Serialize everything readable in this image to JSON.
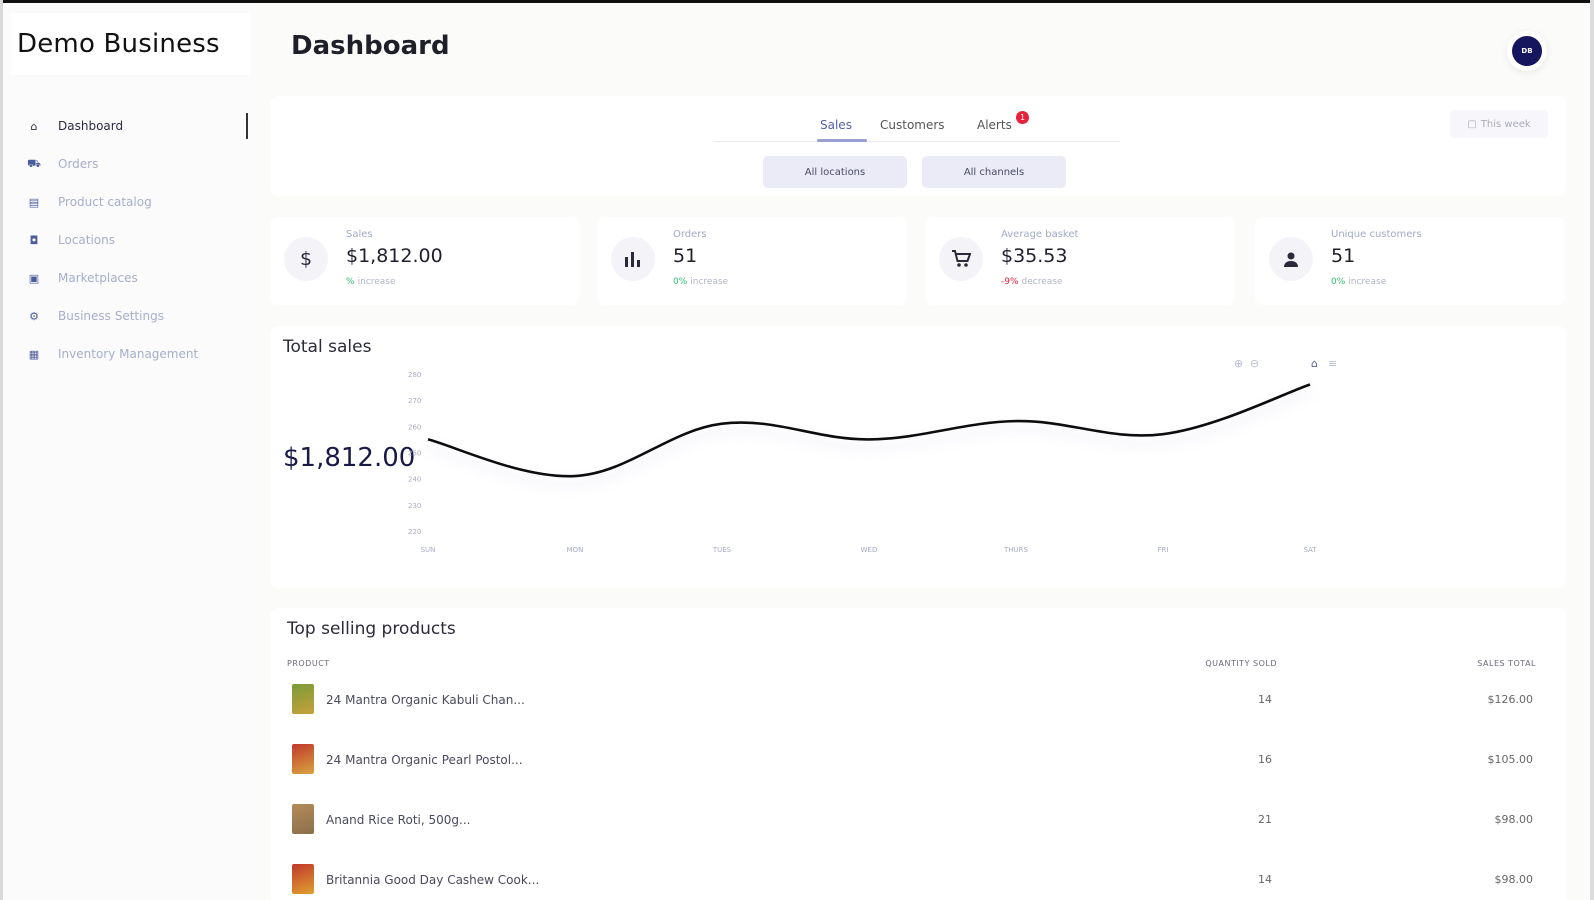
{
  "brand": {
    "name": "Demo Business"
  },
  "sidebar": {
    "items": [
      {
        "label": "Dashboard",
        "icon": "home-icon",
        "glyph": "⌂",
        "active": true
      },
      {
        "label": "Orders",
        "icon": "cart-icon",
        "glyph": "⛟",
        "active": false
      },
      {
        "label": "Product catalog",
        "icon": "catalog-icon",
        "glyph": "▤",
        "active": false
      },
      {
        "label": "Locations",
        "icon": "location-icon",
        "glyph": "◘",
        "active": false
      },
      {
        "label": "Marketplaces",
        "icon": "store-icon",
        "glyph": "▣",
        "active": false
      },
      {
        "label": "Business Settings",
        "icon": "gear-icon",
        "glyph": "⚙",
        "active": false
      },
      {
        "label": "Inventory Management",
        "icon": "inventory-icon",
        "glyph": "▦",
        "active": false
      }
    ]
  },
  "header": {
    "title": "Dashboard",
    "avatar_initials": "DB"
  },
  "filters": {
    "tabs": [
      {
        "label": "Sales",
        "active": true
      },
      {
        "label": "Customers",
        "active": false
      },
      {
        "label": "Alerts",
        "active": false,
        "badge": "1"
      }
    ],
    "period_label": "This week",
    "locations_label": "All locations",
    "channels_label": "All channels"
  },
  "stats": [
    {
      "label": "Sales",
      "value": "$1,812.00",
      "delta": "%",
      "direction": "up",
      "delta_word": "increase",
      "icon": "dollar-icon"
    },
    {
      "label": "Orders",
      "value": "51",
      "delta": "0%",
      "direction": "up",
      "delta_word": "increase",
      "icon": "bar-chart-icon"
    },
    {
      "label": "Average basket",
      "value": "$35.53",
      "delta": "-9%",
      "direction": "down",
      "delta_word": "decrease",
      "icon": "cart-icon"
    },
    {
      "label": "Unique customers",
      "value": "51",
      "delta": "0%",
      "direction": "up",
      "delta_word": "increase",
      "icon": "user-icon"
    }
  ],
  "total_sales": {
    "title": "Total sales",
    "total": "$1,812.00"
  },
  "chart_data": {
    "type": "line",
    "title": "",
    "xlabel": "",
    "ylabel": "",
    "categories": [
      "SUN",
      "MON",
      "TUES",
      "WED",
      "THURS",
      "FRI",
      "SAT"
    ],
    "values": [
      255,
      241,
      261,
      255,
      262,
      257,
      276
    ],
    "yticks": [
      "280",
      "270",
      "260",
      "250",
      "240",
      "230",
      "220"
    ],
    "ylim": [
      220,
      280
    ],
    "grid": false,
    "color": "#111111"
  },
  "products": {
    "title": "Top selling products",
    "columns": [
      "PRODUCT",
      "QUANTITY SOLD",
      "SALES TOTAL"
    ],
    "rows": [
      {
        "name": "24 Mantra Organic Kabuli Chan...",
        "qty": "14",
        "total": "$126.00",
        "thumb_colors": [
          "#7a9a3a",
          "#c7a13a"
        ]
      },
      {
        "name": "24 Mantra Organic Pearl Postol...",
        "qty": "16",
        "total": "$105.00",
        "thumb_colors": [
          "#c0392b",
          "#d9a441"
        ]
      },
      {
        "name": "Anand Rice Roti, 500g...",
        "qty": "21",
        "total": "$98.00",
        "thumb_colors": [
          "#b58b5a",
          "#8a6f4b"
        ]
      },
      {
        "name": "Britannia Good Day Cashew Cook...",
        "qty": "14",
        "total": "$98.00",
        "thumb_colors": [
          "#c0392b",
          "#e0a030"
        ]
      }
    ]
  }
}
